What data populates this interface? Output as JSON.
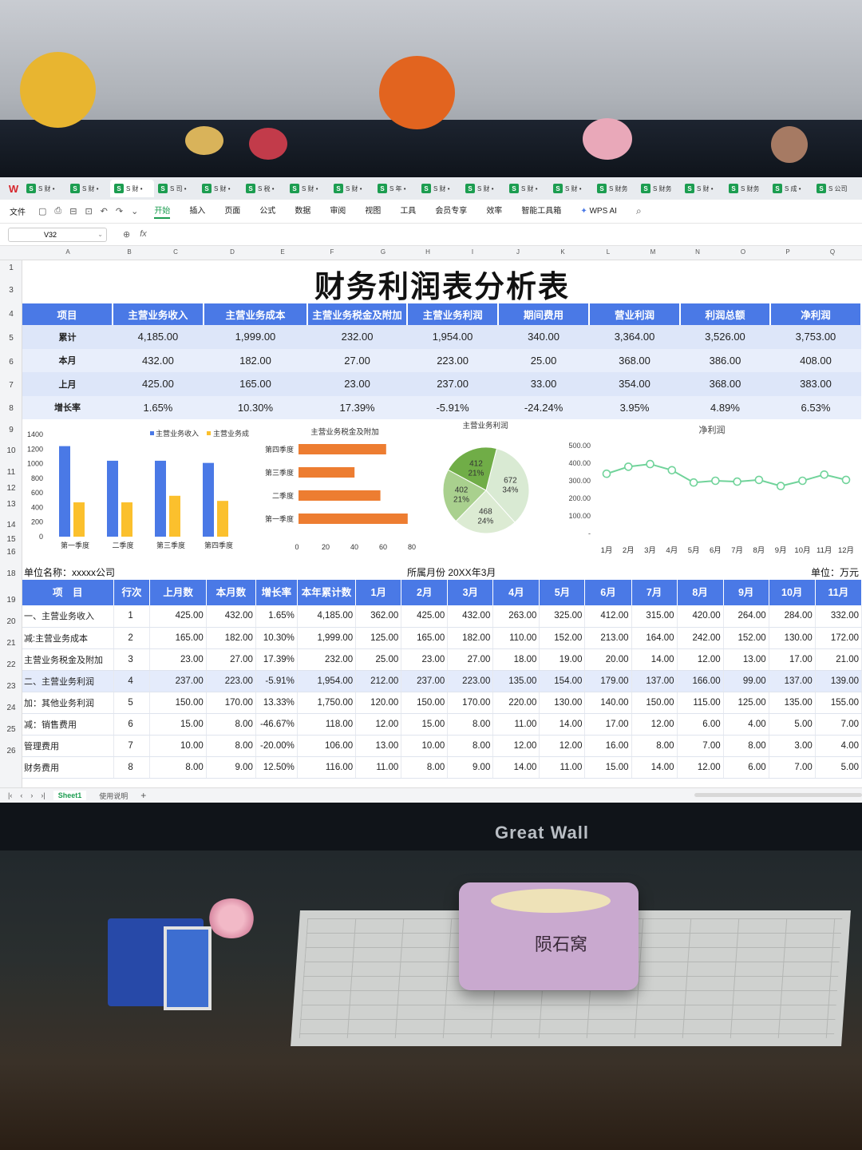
{
  "app": {
    "logo": "W",
    "name_box": "V32",
    "fx_label": "fx",
    "zoom_icon": "magnifier-icon"
  },
  "doc_tabs": [
    {
      "label": "S 财 •",
      "active": false
    },
    {
      "label": "S 财 •",
      "active": false
    },
    {
      "label": "S 财 •",
      "active": true
    },
    {
      "label": "S 司 •",
      "active": false
    },
    {
      "label": "S 财 •",
      "active": false
    },
    {
      "label": "S 税 •",
      "active": false
    },
    {
      "label": "S 财 •",
      "active": false
    },
    {
      "label": "S 财 •",
      "active": false
    },
    {
      "label": "S 年 •",
      "active": false
    },
    {
      "label": "S 财 •",
      "active": false
    },
    {
      "label": "S 财 •",
      "active": false
    },
    {
      "label": "S 财 •",
      "active": false
    },
    {
      "label": "S 财 •",
      "active": false
    },
    {
      "label": "S 财务",
      "active": false
    },
    {
      "label": "S 财务",
      "active": false
    },
    {
      "label": "S 财 •",
      "active": false
    },
    {
      "label": "S 财务",
      "active": false
    },
    {
      "label": "S 成 •",
      "active": false
    },
    {
      "label": "S 公司",
      "active": false
    }
  ],
  "menu": {
    "file": "文件",
    "items": [
      "开始",
      "插入",
      "页面",
      "公式",
      "数据",
      "审阅",
      "视图",
      "工具",
      "会员专享",
      "效率",
      "智能工具箱"
    ],
    "active": "开始",
    "ai": "WPS AI"
  },
  "columns": [
    "A",
    "B",
    "C",
    "D",
    "E",
    "F",
    "G",
    "H",
    "I",
    "J",
    "K",
    "L",
    "M",
    "N",
    "O",
    "P",
    "Q"
  ],
  "rows": [
    "1",
    "3",
    "4",
    "5",
    "6",
    "7",
    "8",
    "9",
    "10",
    "11",
    "12",
    "13",
    "14",
    "15",
    "16",
    "18",
    "19",
    "20",
    "21",
    "22",
    "23",
    "24",
    "25",
    "26"
  ],
  "title": "财务利润表分析表",
  "summary": {
    "headers": [
      "项目",
      "主营业务收入",
      "主营业务成本",
      "主营业务税金及附加",
      "主营业务利润",
      "期间费用",
      "营业利润",
      "利润总额",
      "净利润"
    ],
    "rows": [
      [
        "累计",
        "4,185.00",
        "1,999.00",
        "232.00",
        "1,954.00",
        "340.00",
        "3,364.00",
        "3,526.00",
        "3,753.00"
      ],
      [
        "本月",
        "432.00",
        "182.00",
        "27.00",
        "223.00",
        "25.00",
        "368.00",
        "386.00",
        "408.00"
      ],
      [
        "上月",
        "425.00",
        "165.00",
        "23.00",
        "237.00",
        "33.00",
        "354.00",
        "368.00",
        "383.00"
      ],
      [
        "增长率",
        "1.65%",
        "10.30%",
        "17.39%",
        "-5.91%",
        "-24.24%",
        "3.95%",
        "4.89%",
        "6.53%"
      ]
    ]
  },
  "chart_data": [
    {
      "type": "bar",
      "title": "",
      "legend": [
        "主营业务收入",
        "主营业务成"
      ],
      "categories": [
        "第一季度",
        "二季度",
        "第三季度",
        "第四季度"
      ],
      "series": [
        {
          "name": "主营业务收入",
          "values": [
            1240,
            1040,
            1040,
            1010
          ],
          "color": "#4a79e6"
        },
        {
          "name": "主营业务成",
          "values": [
            470,
            470,
            560,
            490
          ],
          "color": "#fbc02d"
        }
      ],
      "yticks": [
        "0",
        "200",
        "400",
        "600",
        "800",
        "1000",
        "1200",
        "1400"
      ],
      "ylim": [
        0,
        1400
      ]
    },
    {
      "type": "bar",
      "orientation": "horizontal",
      "title": "主营业务税金及附加",
      "categories": [
        "第四季度",
        "第三季度",
        "二季度",
        "第一季度"
      ],
      "values": [
        61,
        39,
        57,
        76
      ],
      "color": "#ed7d31",
      "xticks": [
        "0",
        "20",
        "40",
        "60",
        "80"
      ],
      "xlim": [
        0,
        80
      ]
    },
    {
      "type": "pie",
      "title": "主营业务利润",
      "slices": [
        {
          "value": 672,
          "pct": "34%",
          "color": "#d9ead3"
        },
        {
          "value": 468,
          "pct": "24%",
          "color": "#dcebd3"
        },
        {
          "value": 402,
          "pct": "21%",
          "color": "#a9d08e"
        },
        {
          "value": 412,
          "pct": "21%",
          "color": "#70ad47"
        }
      ]
    },
    {
      "type": "line",
      "title": "净利润",
      "categories": [
        "1月",
        "2月",
        "3月",
        "4月",
        "5月",
        "6月",
        "7月",
        "8月",
        "9月",
        "10月",
        "11月",
        "12月"
      ],
      "values": [
        340,
        380,
        395,
        360,
        290,
        300,
        295,
        305,
        270,
        300,
        335,
        305
      ],
      "color": "#70d39a",
      "yticks": [
        "500.00",
        "400.00",
        "300.00",
        "200.00",
        "100.00",
        "-"
      ],
      "ylim": [
        0,
        500
      ]
    }
  ],
  "info": {
    "unit_name": "单位名称：xxxxx公司",
    "month": "所属月份 20XX年3月",
    "unit": "单位：万元"
  },
  "detail": {
    "headers": [
      "项　目",
      "行次",
      "上月数",
      "本月数",
      "增长率",
      "本年累计数",
      "1月",
      "2月",
      "3月",
      "4月",
      "5月",
      "6月",
      "7月",
      "8月",
      "9月",
      "10月",
      "11月"
    ],
    "rows": [
      [
        "一、主营业务收入",
        "1",
        "425.00",
        "432.00",
        "1.65%",
        "4,185.00",
        "362.00",
        "425.00",
        "432.00",
        "263.00",
        "325.00",
        "412.00",
        "315.00",
        "420.00",
        "264.00",
        "284.00",
        "332.00"
      ],
      [
        "减:主营业务成本",
        "2",
        "165.00",
        "182.00",
        "10.30%",
        "1,999.00",
        "125.00",
        "165.00",
        "182.00",
        "110.00",
        "152.00",
        "213.00",
        "164.00",
        "242.00",
        "152.00",
        "130.00",
        "172.00"
      ],
      [
        "主营业务税金及附加",
        "3",
        "23.00",
        "27.00",
        "17.39%",
        "232.00",
        "25.00",
        "23.00",
        "27.00",
        "18.00",
        "19.00",
        "20.00",
        "14.00",
        "12.00",
        "13.00",
        "17.00",
        "21.00"
      ],
      [
        "二、主营业务利润",
        "4",
        "237.00",
        "223.00",
        "-5.91%",
        "1,954.00",
        "212.00",
        "237.00",
        "223.00",
        "135.00",
        "154.00",
        "179.00",
        "137.00",
        "166.00",
        "99.00",
        "137.00",
        "139.00"
      ],
      [
        "加：其他业务利润",
        "5",
        "150.00",
        "170.00",
        "13.33%",
        "1,750.00",
        "120.00",
        "150.00",
        "170.00",
        "220.00",
        "130.00",
        "140.00",
        "150.00",
        "115.00",
        "125.00",
        "135.00",
        "155.00"
      ],
      [
        "减：销售费用",
        "6",
        "15.00",
        "8.00",
        "-46.67%",
        "118.00",
        "12.00",
        "15.00",
        "8.00",
        "11.00",
        "14.00",
        "17.00",
        "12.00",
        "6.00",
        "4.00",
        "5.00",
        "7.00"
      ],
      [
        "管理费用",
        "7",
        "10.00",
        "8.00",
        "-20.00%",
        "106.00",
        "13.00",
        "10.00",
        "8.00",
        "12.00",
        "12.00",
        "16.00",
        "8.00",
        "7.00",
        "8.00",
        "3.00",
        "4.00"
      ],
      [
        "财务费用",
        "8",
        "8.00",
        "9.00",
        "12.50%",
        "116.00",
        "11.00",
        "8.00",
        "9.00",
        "14.00",
        "11.00",
        "15.00",
        "14.00",
        "12.00",
        "6.00",
        "7.00",
        "5.00"
      ]
    ]
  },
  "sheet_tabs": [
    "Sheet1",
    "使用说明"
  ],
  "add_sheet": "+",
  "photo": {
    "monitor_brand": "Great Wall",
    "printer_brand": "陨石窝"
  }
}
